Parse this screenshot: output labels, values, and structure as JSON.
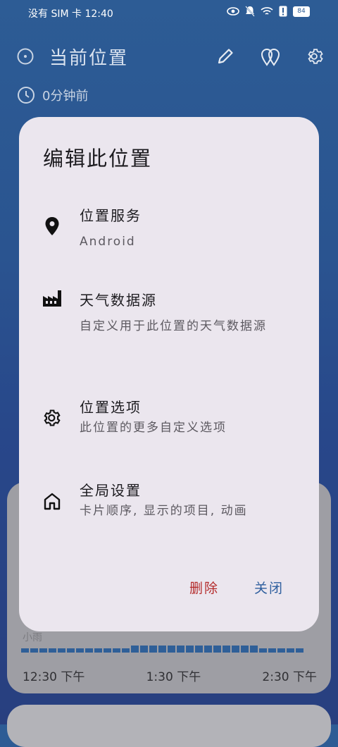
{
  "status": {
    "left_text": "没有 SIM 卡 12:40",
    "battery": "84"
  },
  "header": {
    "title": "当前位置"
  },
  "updated": {
    "text": "0分钟前"
  },
  "background_card": {
    "label": "小雨",
    "times": [
      "12:30 下午",
      "1:30 下午",
      "2:30 下午"
    ]
  },
  "dialog": {
    "title": "编辑此位置",
    "items": [
      {
        "title": "位置服务",
        "subtitle": "Android",
        "icon": "location-pin-icon"
      },
      {
        "title": "天气数据源",
        "subtitle": "自定义用于此位置的天气数据源",
        "icon": "factory-icon"
      },
      {
        "title": "位置选项",
        "subtitle": "此位置的更多自定义选项",
        "icon": "gear-icon"
      },
      {
        "title": "全局设置",
        "subtitle": "卡片顺序, 显示的项目, 动画",
        "icon": "home-icon"
      }
    ],
    "delete_label": "删除",
    "close_label": "关闭"
  },
  "colors": {
    "accent": "#2f5f9e",
    "danger": "#b42a2a",
    "dialog_bg": "#ebe6ee"
  }
}
